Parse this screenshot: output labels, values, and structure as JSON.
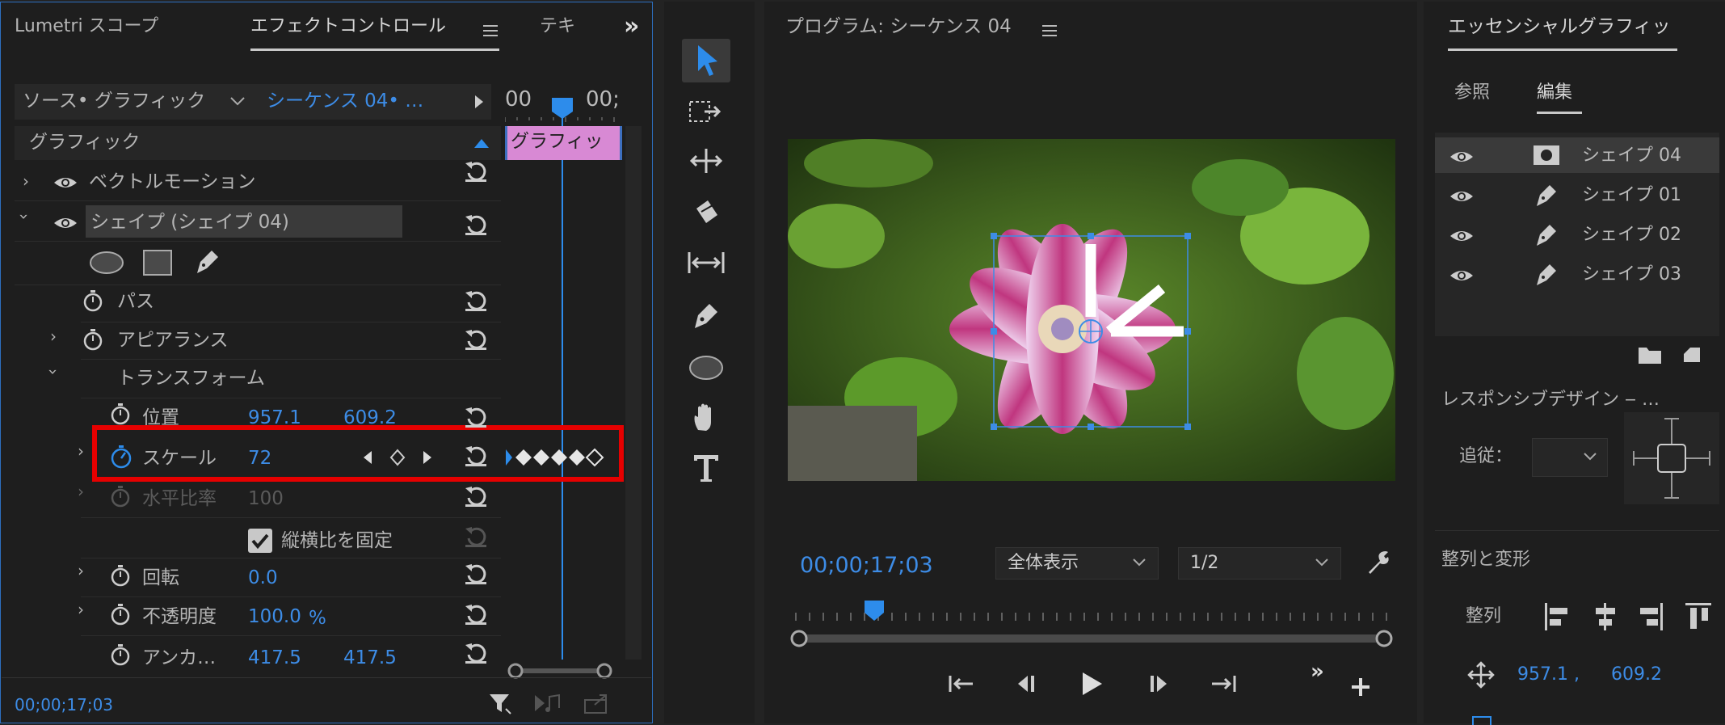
{
  "left_panel": {
    "tabs": {
      "lumetri": "Lumetri スコープ",
      "effect": "エフェクトコントロール",
      "text": "テキ",
      "more": "»"
    },
    "source_label": "ソース• グラフィック",
    "sequence_label": "シーケンス 04• …",
    "timecode_start": "00",
    "timecode_end": "00;",
    "clip_label": "グラフィッ",
    "section_title": "グラフィック",
    "rows": {
      "vector_motion": "ベクトルモーション",
      "shape": "シェイプ (シェイプ 04)",
      "path": "パス",
      "appearance": "アピアランス",
      "transform": "トランスフォーム",
      "position": "位置",
      "position_x": "957.1",
      "position_y": "609.2",
      "scale": "スケール",
      "scale_value": "72",
      "h_ratio": "水平比率",
      "h_ratio_value": "100",
      "lock_ratio": "縦横比を固定",
      "rotation": "回転",
      "rotation_value": "0.0",
      "opacity": "不透明度",
      "opacity_value": "100.0",
      "opacity_unit": "%",
      "anchor": "アンカ…",
      "anchor_x": "417.5",
      "anchor_y": "417.5"
    },
    "footer_timecode": "00;00;17;03"
  },
  "program": {
    "title": "プログラム: シーケンス 04",
    "timecode": "00;00;17;03",
    "zoom": "全体表示",
    "resolution": "1/2"
  },
  "right_panel": {
    "title": "エッセンシャルグラフィッ",
    "tab_browse": "参照",
    "tab_edit": "編集",
    "layers": [
      "シェイプ 04",
      "シェイプ 01",
      "シェイプ 02",
      "シェイプ 03"
    ],
    "responsive": "レスポンシブデザイン ‒ …",
    "follow_label": "追従：",
    "align_title": "整列と変形",
    "align_label": "整列",
    "pos_x": "957.1 ,",
    "pos_y": "609.2"
  },
  "colors": {
    "accent": "#2d8ceb",
    "highlight_box": "#e60000",
    "clip": "#d889d4"
  }
}
